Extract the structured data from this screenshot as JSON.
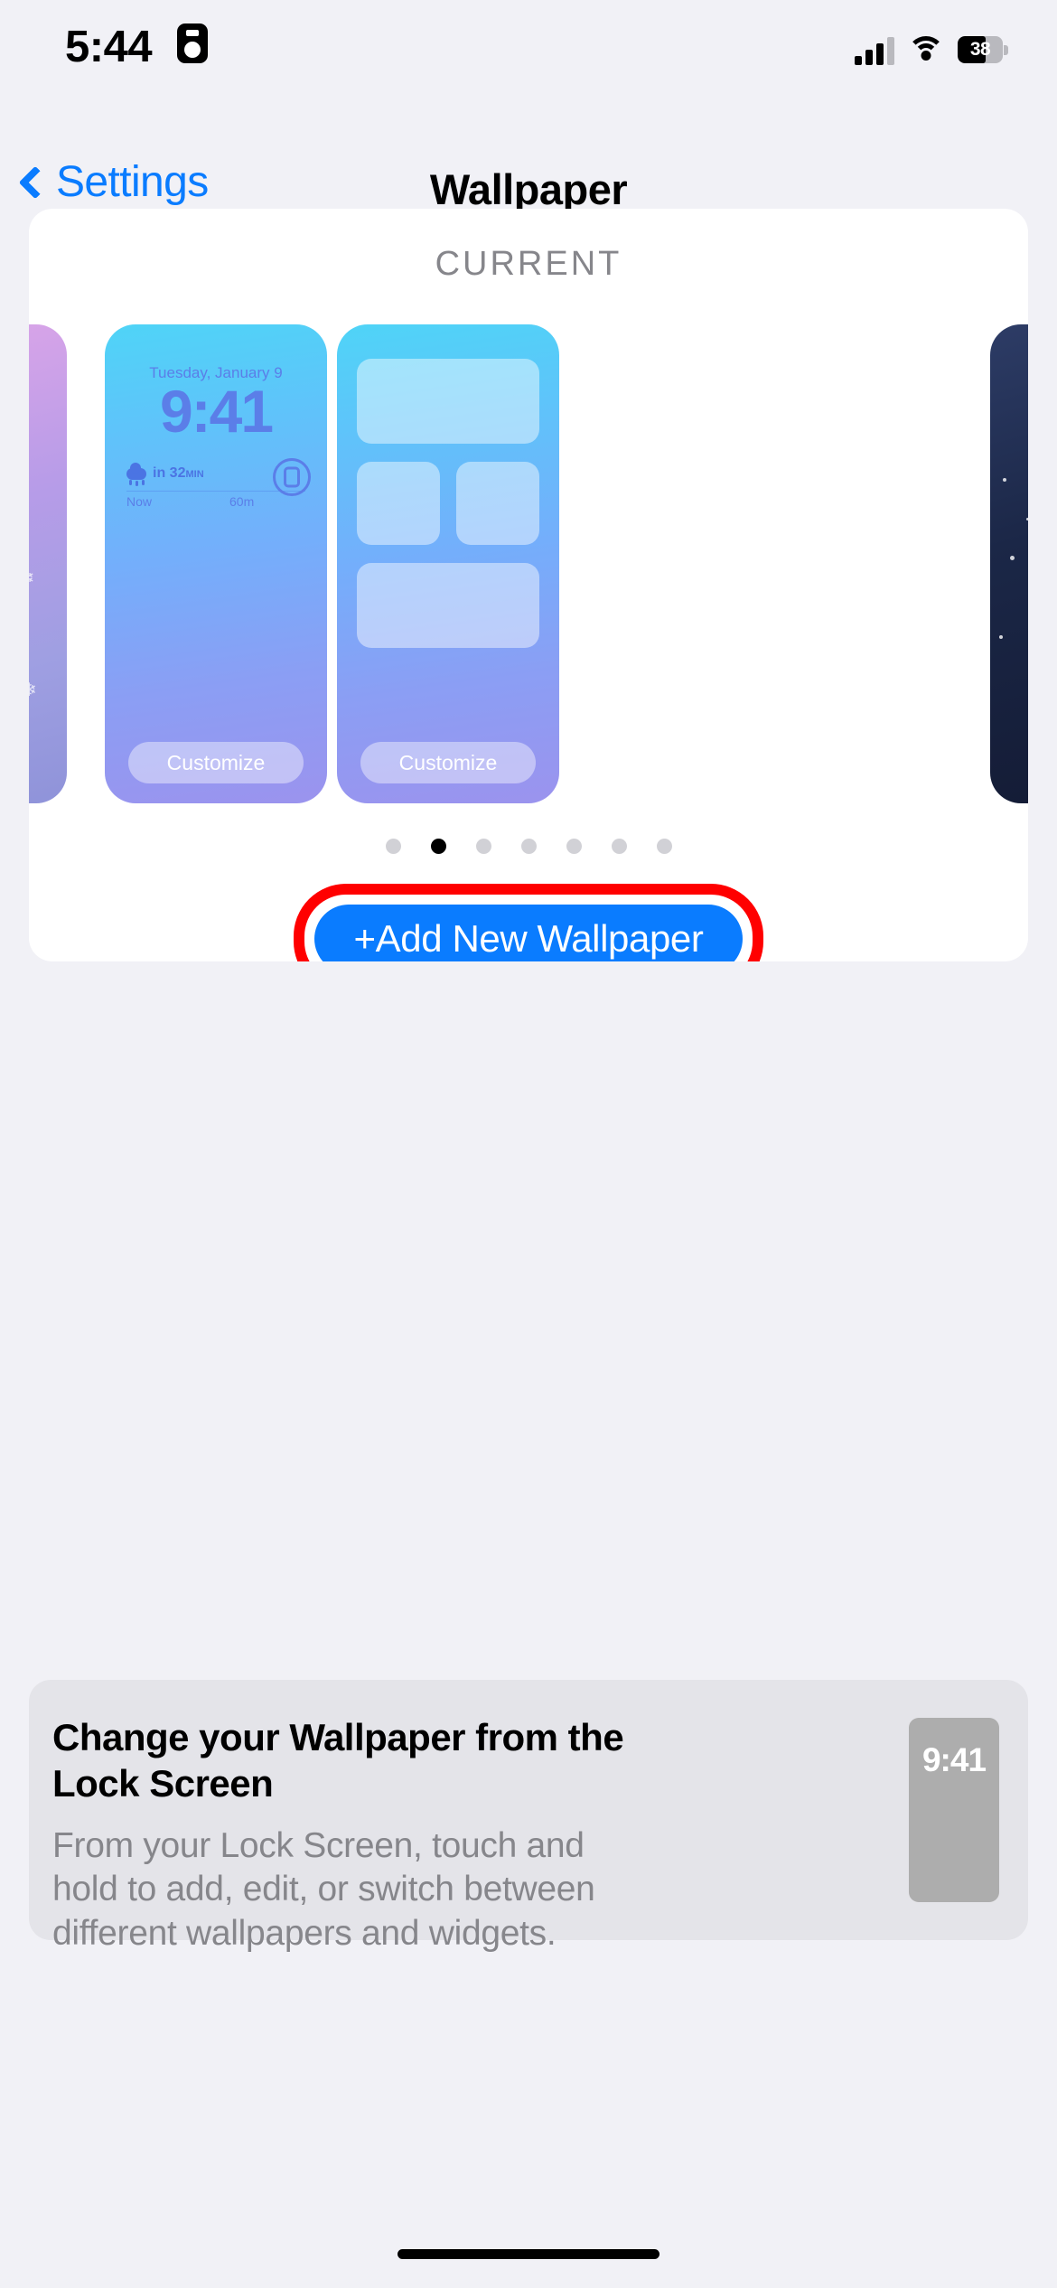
{
  "status_bar": {
    "time": "5:44",
    "recording_icon": "lock-recording-icon",
    "signal_icon": "cellular-signal-icon",
    "wifi_icon": "wifi-icon",
    "battery_percent": "38"
  },
  "nav": {
    "back_label": "Settings",
    "back_icon": "chevron-left-icon",
    "title": "Wallpaper"
  },
  "current_section": {
    "label": "CURRENT",
    "lock_preview": {
      "date": "Tuesday, January 9",
      "time": "9:41",
      "weather_prefix": "in 32",
      "weather_unit": "MIN",
      "timeline_start": "Now",
      "timeline_end": "60m",
      "customize_label": "Customize"
    },
    "home_preview": {
      "customize_label": "Customize"
    },
    "page_dots": {
      "count": 7,
      "active_index": 1
    },
    "add_button": {
      "label": "+Add New Wallpaper",
      "color": "#0a7cff",
      "highlight_color": "#ff0000"
    }
  },
  "info_card": {
    "title": "Change your Wallpaper from the Lock Screen",
    "body": "From your Lock Screen, touch and hold to add, edit, or switch between different wallpapers and widgets.",
    "thumbnail_time": "9:41"
  },
  "colors": {
    "page_background": "#f1f1f6",
    "card_background": "#ffffff",
    "info_background": "#e4e4e9",
    "accent_blue": "#0a7cff",
    "secondary_text": "#86868b"
  }
}
